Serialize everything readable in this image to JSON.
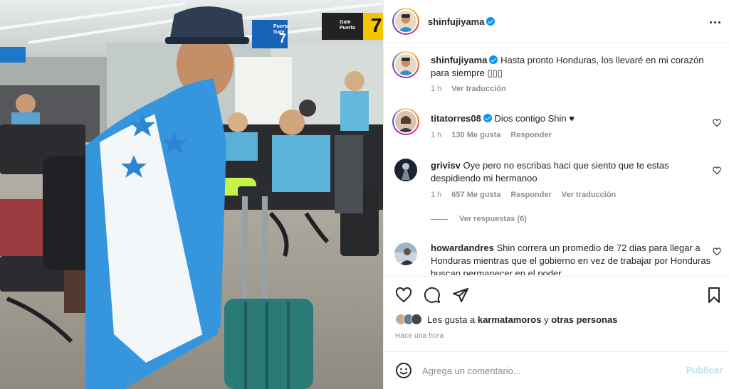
{
  "photo": {
    "alt_scene": "",
    "gate_sign": {
      "line1": "Puerta",
      "line2": "Gate",
      "number": "7"
    },
    "gate_sign_right": {
      "line1": "Gate",
      "line2": "Puerta",
      "number": "7"
    }
  },
  "header": {
    "username": "shinfujiyama",
    "verified": true,
    "more_icon": "more-horizontal-icon"
  },
  "caption": {
    "username": "shinfujiyama",
    "text": "Hasta pronto Honduras, los llevaré en mi corazón para siempre ▯▯▯",
    "time": "1 h",
    "translate": "Ver traducción"
  },
  "comments": [
    {
      "username": "titatorres08",
      "verified": true,
      "text": "Dios contigo Shin ♥",
      "time": "1 h",
      "likes": "130 Me gusta",
      "reply": "Responder"
    },
    {
      "username": "grivisv",
      "text": "Oye pero no escribas haci que siento que te estas despidiendo mi hermanoo",
      "time": "1 h",
      "likes": "657 Me gusta",
      "reply": "Responder",
      "translate": "Ver traducción",
      "view_replies": "Ver respuestas (6)"
    },
    {
      "username": "howardandres",
      "text": "Shin correra un promedio de 72 dias para llegar a Honduras mientras que el gobierno en vez de trabajar por Honduras buscan permanecer en el poder"
    }
  ],
  "actions": {
    "like_icon": "heart-icon",
    "comment_icon": "comment-icon",
    "share_icon": "share-icon",
    "save_icon": "bookmark-icon",
    "likes_prefix": "Les gusta a",
    "likes_user": "karmatamoros",
    "likes_join": "y",
    "likes_others": "otras personas",
    "time_ago": "Hace una hora"
  },
  "compose": {
    "emoji_icon": "emoji-icon",
    "placeholder": "Agrega un comentario...",
    "publish": "Publicar"
  },
  "colors": {
    "accent": "#0095f6",
    "publish_disabled": "#b2dffc",
    "muted": "#8e8e8e",
    "text": "#262626"
  }
}
